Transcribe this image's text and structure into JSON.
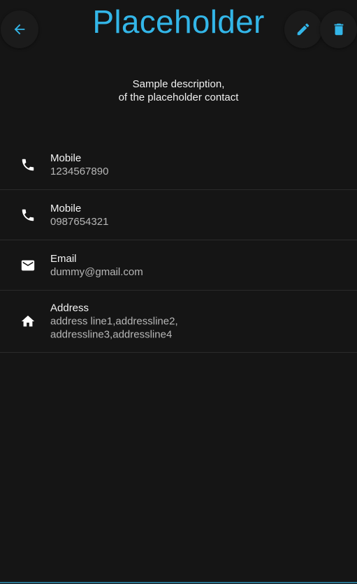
{
  "header": {
    "title": "Placeholder",
    "back_icon": "arrow-back-icon",
    "edit_icon": "pencil-icon",
    "delete_icon": "trash-icon"
  },
  "description": {
    "line1": "Sample description,",
    "line2": "of the placeholder contact"
  },
  "contacts": [
    {
      "icon": "phone-icon",
      "label": "Mobile",
      "value": "1234567890"
    },
    {
      "icon": "phone-icon",
      "label": "Mobile",
      "value": "0987654321"
    },
    {
      "icon": "email-icon",
      "label": "Email",
      "value": "dummy@gmail.com"
    },
    {
      "icon": "home-icon",
      "label": "Address",
      "value": "address line1,addressline2,\naddressline3,addressline4"
    }
  ],
  "colors": {
    "accent": "#33b6e8",
    "background": "#151515",
    "divider": "#2b2b2b",
    "text_primary": "#f5f5f5",
    "text_secondary": "#b7b7b7"
  }
}
